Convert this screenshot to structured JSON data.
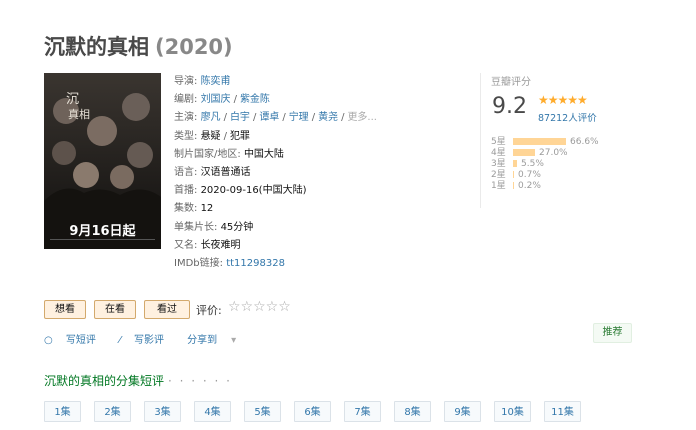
{
  "title": {
    "name": "沉默的真相",
    "year": "(2020)"
  },
  "poster": {
    "date_text": "9月16日起"
  },
  "info": {
    "director_label": "导演:",
    "director": "陈奕甫",
    "writer_label": "编剧:",
    "writers": [
      "刘国庆",
      "紫金陈"
    ],
    "cast_label": "主演:",
    "cast": [
      "廖凡",
      "白宇",
      "谭卓",
      "宁理",
      "黄尧"
    ],
    "cast_more": "更多...",
    "genre_label": "类型:",
    "genres": [
      "悬疑",
      "犯罪"
    ],
    "region_label": "制片国家/地区:",
    "region": "中国大陆",
    "language_label": "语言:",
    "language": "汉语普通话",
    "premiere_label": "首播:",
    "premiere": "2020-09-16(中国大陆)",
    "episodes_label": "集数:",
    "episodes": "12",
    "runtime_label": "单集片长:",
    "runtime": "45分钟",
    "aka_label": "又名:",
    "aka": "长夜难明",
    "imdb_label": "IMDb链接:",
    "imdb": "tt11298328"
  },
  "rating": {
    "label": "豆瓣评分",
    "score": "9.2",
    "stars": "★★★★★",
    "count": "87212人评价",
    "breakdown": [
      {
        "star": "5星",
        "percent": "66.6%",
        "value": 66.6
      },
      {
        "star": "4星",
        "percent": "27.0%",
        "value": 27.0
      },
      {
        "star": "3星",
        "percent": "5.5%",
        "value": 5.5
      },
      {
        "star": "2星",
        "percent": "0.7%",
        "value": 0.7
      },
      {
        "star": "1星",
        "percent": "0.2%",
        "value": 0.2
      }
    ]
  },
  "actions": {
    "want": "想看",
    "watching": "在看",
    "watched": "看过",
    "rate_label": "评价:",
    "rate_stars": "☆☆☆☆☆"
  },
  "links": {
    "short_review": "写短评",
    "review": "写影评",
    "share": "分享到"
  },
  "recommend": "推荐",
  "episode_section": {
    "title": "沉默的真相的分集短评",
    "dots": "· · · · · ·"
  },
  "episodes": [
    "1集",
    "2集",
    "3集",
    "4集",
    "5集",
    "6集",
    "7集",
    "8集",
    "9集",
    "10集",
    "11集"
  ]
}
